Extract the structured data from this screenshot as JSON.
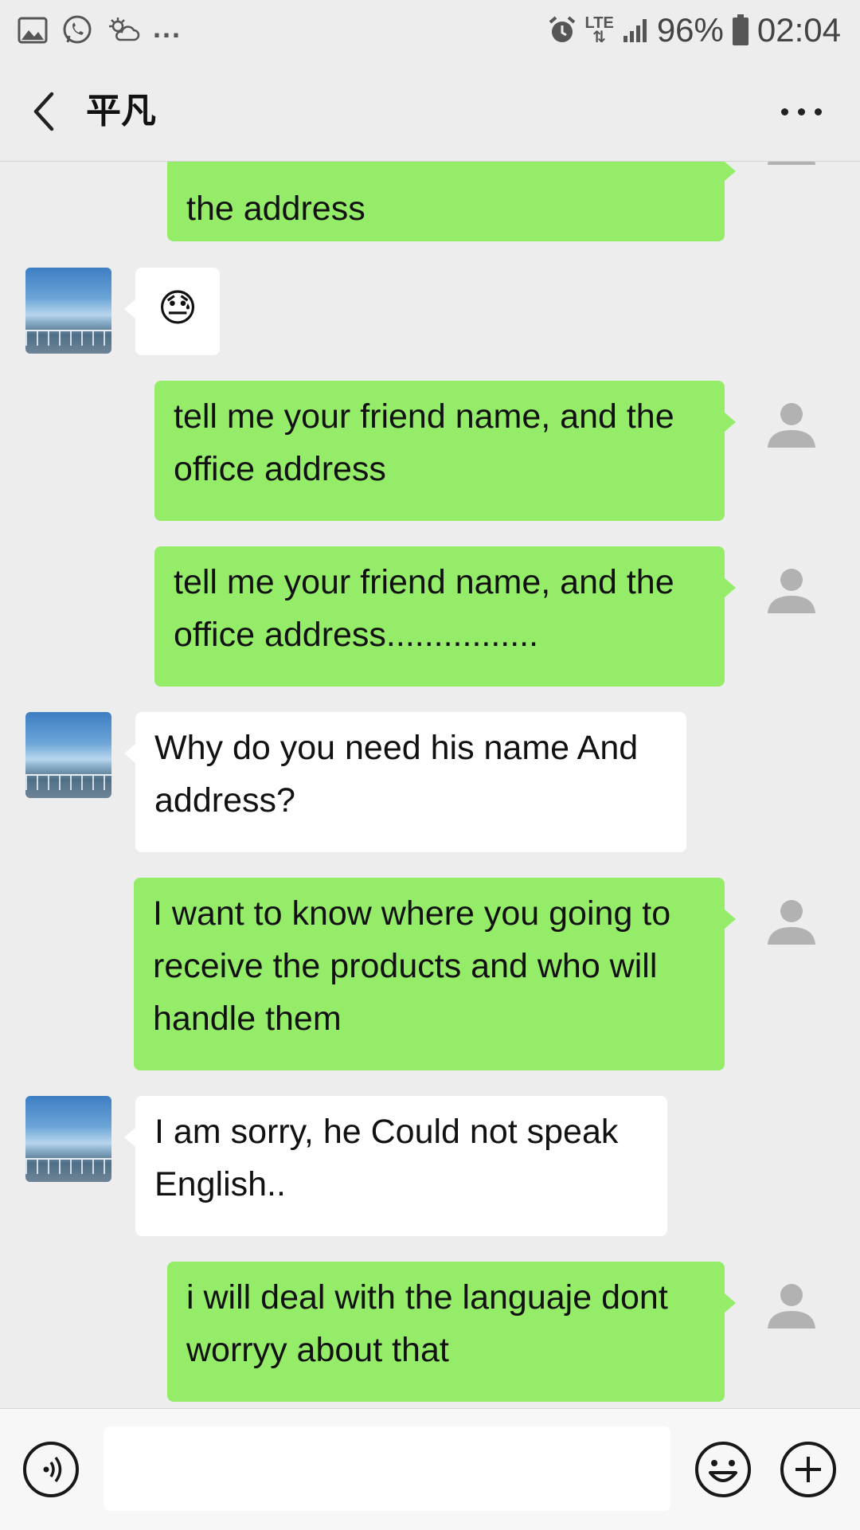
{
  "status_bar": {
    "overflow": "...",
    "network": "LTE",
    "battery": "96%",
    "time": "02:04",
    "icons": [
      "gallery-icon",
      "whatsapp-icon",
      "weather-icon",
      "alarm-icon",
      "signal-icon",
      "battery-icon"
    ]
  },
  "header": {
    "title": "平凡",
    "back_icon": "chevron-left-icon",
    "more_icon": "more-dots-icon"
  },
  "messages": [
    {
      "side": "out",
      "text": "the address"
    },
    {
      "side": "in",
      "text": "😓"
    },
    {
      "side": "out",
      "text": "tell me your friend name, and the office address"
    },
    {
      "side": "out",
      "text": "tell me your friend name, and the office address................"
    },
    {
      "side": "in",
      "text": "Why do you need his name And address?"
    },
    {
      "side": "out",
      "text": "I want to know where you going to receive the products and who will handle them"
    },
    {
      "side": "in",
      "text": "I am sorry, he Could not speak English.."
    },
    {
      "side": "out",
      "text": "i will deal with the languaje dont worryy about that"
    }
  ],
  "input_bar": {
    "value": "",
    "voice_icon": "voice-icon",
    "emoji_icon": "emoji-icon",
    "plus_icon": "plus-icon"
  },
  "colors": {
    "outgoing_bubble": "#95ec69",
    "incoming_bubble": "#ffffff",
    "background": "#ededed"
  }
}
